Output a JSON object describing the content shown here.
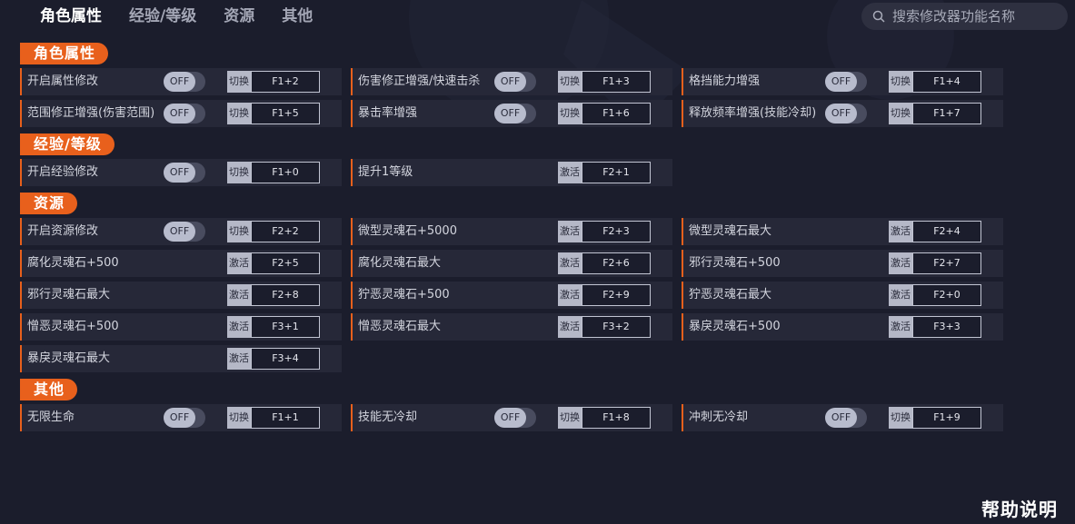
{
  "nav": {
    "tabs": [
      "角色属性",
      "经验/等级",
      "资源",
      "其他"
    ],
    "active_index": 0
  },
  "search": {
    "placeholder": "搜索修改器功能名称"
  },
  "colors": {
    "accent": "#e8601c",
    "background": "#1b1d2c",
    "item_bg": "#262838"
  },
  "sections": [
    {
      "title": "角色属性",
      "items": [
        {
          "label": "开启属性修改",
          "toggle": "OFF",
          "action": "切换",
          "key": "F1+2"
        },
        {
          "label": "伤害修正增强/快速击杀",
          "toggle": "OFF",
          "action": "切换",
          "key": "F1+3"
        },
        {
          "label": "格挡能力增强",
          "toggle": "OFF",
          "action": "切换",
          "key": "F1+4"
        },
        {
          "label": "范围修正增强(伤害范围)",
          "toggle": "OFF",
          "action": "切换",
          "key": "F1+5"
        },
        {
          "label": "暴击率增强",
          "toggle": "OFF",
          "action": "切换",
          "key": "F1+6"
        },
        {
          "label": "释放频率增强(技能冷却)",
          "toggle": "OFF",
          "action": "切换",
          "key": "F1+7"
        }
      ]
    },
    {
      "title": "经验/等级",
      "items": [
        {
          "label": "开启经验修改",
          "toggle": "OFF",
          "action": "切换",
          "key": "F1+0"
        },
        {
          "label": "提升1等级",
          "action": "激活",
          "key": "F2+1"
        }
      ]
    },
    {
      "title": "资源",
      "items": [
        {
          "label": "开启资源修改",
          "toggle": "OFF",
          "action": "切换",
          "key": "F2+2"
        },
        {
          "label": "微型灵魂石+5000",
          "action": "激活",
          "key": "F2+3"
        },
        {
          "label": "微型灵魂石最大",
          "action": "激活",
          "key": "F2+4"
        },
        {
          "label": "腐化灵魂石+500",
          "action": "激活",
          "key": "F2+5"
        },
        {
          "label": "腐化灵魂石最大",
          "action": "激活",
          "key": "F2+6"
        },
        {
          "label": "邪行灵魂石+500",
          "action": "激活",
          "key": "F2+7"
        },
        {
          "label": "邪行灵魂石最大",
          "action": "激活",
          "key": "F2+8"
        },
        {
          "label": "狞恶灵魂石+500",
          "action": "激活",
          "key": "F2+9"
        },
        {
          "label": "狞恶灵魂石最大",
          "action": "激活",
          "key": "F2+0"
        },
        {
          "label": "憎恶灵魂石+500",
          "action": "激活",
          "key": "F3+1"
        },
        {
          "label": "憎恶灵魂石最大",
          "action": "激活",
          "key": "F3+2"
        },
        {
          "label": "暴戾灵魂石+500",
          "action": "激活",
          "key": "F3+3"
        },
        {
          "label": "暴戾灵魂石最大",
          "action": "激活",
          "key": "F3+4"
        }
      ]
    },
    {
      "title": "其他",
      "items": [
        {
          "label": "无限生命",
          "toggle": "OFF",
          "action": "切换",
          "key": "F1+1"
        },
        {
          "label": "技能无冷却",
          "toggle": "OFF",
          "action": "切换",
          "key": "F1+8"
        },
        {
          "label": "冲刺无冷却",
          "toggle": "OFF",
          "action": "切换",
          "key": "F1+9"
        }
      ]
    }
  ],
  "help_label": "帮助说明"
}
